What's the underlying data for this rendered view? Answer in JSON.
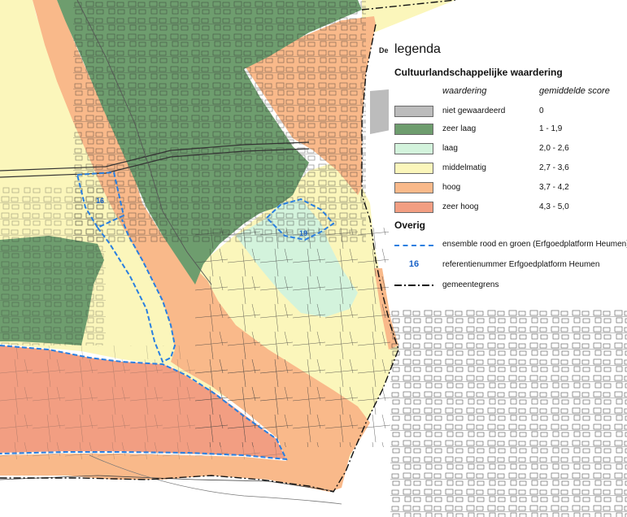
{
  "map": {
    "labels": {
      "ensemble_a": "16",
      "ensemble_b": "19",
      "cut_text": "De"
    }
  },
  "legend": {
    "title": "legenda",
    "section_title": "Cultuurlandschappelijke waardering",
    "column_waardering": "waardering",
    "column_score": "gemiddelde score",
    "classes": [
      {
        "label": "niet gewaardeerd",
        "score": "0",
        "color": "#bcbcbc"
      },
      {
        "label": "zeer laag",
        "score": "1 - 1,9",
        "color": "#6e9d6e"
      },
      {
        "label": "laag",
        "score": "2,0 - 2,6",
        "color": "#d3f3dc"
      },
      {
        "label": "middelmatig",
        "score": "2,7 - 3,6",
        "color": "#fbf6bb"
      },
      {
        "label": "hoog",
        "score": "3,7 - 4,2",
        "color": "#f9b98a"
      },
      {
        "label": "zeer hoog",
        "score": "4,3 - 5,0",
        "color": "#f29e82"
      }
    ],
    "overig_title": "Overig",
    "overig": [
      {
        "symbol": "dashed-blue-line",
        "label": "ensemble rood en groen (Erfgoedplatform Heumen)",
        "color": "#2a7fe0"
      },
      {
        "symbol": "number",
        "number": "16",
        "label": "referentienummer Erfgoedplatform Heumen",
        "color": "#1a63c8"
      },
      {
        "symbol": "dash-dot-black-line",
        "label": "gemeentegrens",
        "color": "#111111"
      }
    ]
  }
}
